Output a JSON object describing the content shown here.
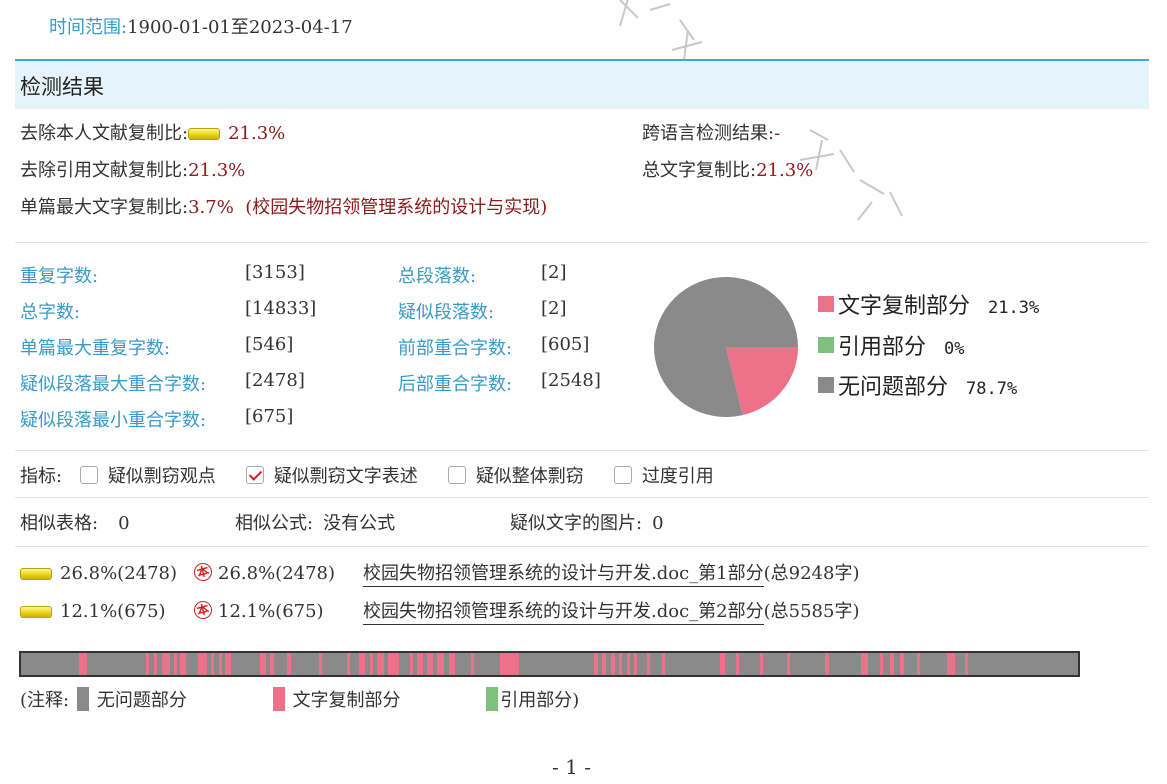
{
  "time_range": {
    "label": "时间范围:",
    "value": "1900-01-01至2023-04-17"
  },
  "header": {
    "title": "检测结果"
  },
  "results": {
    "excl_self_label": "去除本人文献复制比:",
    "excl_self_value": "21.3%",
    "cross_lang_label": "跨语言检测结果:",
    "cross_lang_value": "-",
    "excl_ref_label": "去除引用文献复制比:",
    "excl_ref_value": "21.3%",
    "total_ratio_label": "总文字复制比:",
    "total_ratio_value": "21.3%",
    "max_single_label": "单篇最大文字复制比:",
    "max_single_value": "3.7%",
    "max_single_source": "(校园失物招领管理系统的设计与实现)"
  },
  "stats": [
    {
      "label": "重复字数:",
      "value": "[3153]"
    },
    {
      "label": "总段落数:",
      "value": "[2]"
    },
    {
      "label": "总字数:",
      "value": "[14833]"
    },
    {
      "label": "疑似段落数:",
      "value": "[2]"
    },
    {
      "label": "单篇最大重复字数:",
      "value": "[546]"
    },
    {
      "label": "前部重合字数:",
      "value": "[605]"
    },
    {
      "label": "疑似段落最大重合字数:",
      "value": "[2478]"
    },
    {
      "label": "后部重合字数:",
      "value": "[2548]"
    },
    {
      "label": "疑似段落最小重合字数:",
      "value": "[675]"
    }
  ],
  "chart_data": {
    "type": "pie",
    "slices": [
      {
        "label": "文字复制部分",
        "value": 21.3,
        "pct_label": "21.3%",
        "color": "#ec7189"
      },
      {
        "label": "引用部分",
        "value": 0,
        "pct_label": "0%",
        "color": "#7fc07f"
      },
      {
        "label": "无问题部分",
        "value": 78.7,
        "pct_label": "78.7%",
        "color": "#8a8a8a"
      }
    ]
  },
  "indicators": {
    "label": "指标:",
    "items": [
      {
        "label": "疑似剽窃观点",
        "checked": false
      },
      {
        "label": "疑似剽窃文字表述",
        "checked": true
      },
      {
        "label": "疑似整体剽窃",
        "checked": false
      },
      {
        "label": "过度引用",
        "checked": false
      }
    ]
  },
  "similar": {
    "tables_label": "相似表格:",
    "tables_value": "0",
    "formulas_label": "相似公式:",
    "formulas_value": "没有公式",
    "images_label": "疑似文字的图片:",
    "images_value": "0"
  },
  "sources": [
    {
      "ratio": "26.8%(2478)",
      "own_ratio": "26.8%(2478)",
      "title": "校园失物招领管理系统的设计与开发.doc_第1部分",
      "total": "(总9248字)"
    },
    {
      "ratio": "12.1%(675)",
      "own_ratio": "12.1%(675)",
      "title": "校园失物招领管理系统的设计与开发.doc_第2部分",
      "total": "(总5585字)"
    }
  ],
  "stamp_char": "本",
  "strip_marks": [
    {
      "s": 0.055,
      "w": 0.007
    },
    {
      "s": 0.118,
      "w": 0.003
    },
    {
      "s": 0.126,
      "w": 0.003
    },
    {
      "s": 0.133,
      "w": 0.008
    },
    {
      "s": 0.145,
      "w": 0.003
    },
    {
      "s": 0.15,
      "w": 0.006
    },
    {
      "s": 0.167,
      "w": 0.009
    },
    {
      "s": 0.18,
      "w": 0.003
    },
    {
      "s": 0.187,
      "w": 0.003
    },
    {
      "s": 0.193,
      "w": 0.006
    },
    {
      "s": 0.226,
      "w": 0.006
    },
    {
      "s": 0.236,
      "w": 0.003
    },
    {
      "s": 0.252,
      "w": 0.003
    },
    {
      "s": 0.282,
      "w": 0.003
    },
    {
      "s": 0.308,
      "w": 0.003
    },
    {
      "s": 0.32,
      "w": 0.005
    },
    {
      "s": 0.33,
      "w": 0.003
    },
    {
      "s": 0.337,
      "w": 0.006
    },
    {
      "s": 0.347,
      "w": 0.011
    },
    {
      "s": 0.368,
      "w": 0.003
    },
    {
      "s": 0.375,
      "w": 0.005
    },
    {
      "s": 0.384,
      "w": 0.006
    },
    {
      "s": 0.394,
      "w": 0.006
    },
    {
      "s": 0.405,
      "w": 0.006
    },
    {
      "s": 0.426,
      "w": 0.003
    },
    {
      "s": 0.453,
      "w": 0.018
    },
    {
      "s": 0.542,
      "w": 0.004
    },
    {
      "s": 0.55,
      "w": 0.003
    },
    {
      "s": 0.558,
      "w": 0.004
    },
    {
      "s": 0.566,
      "w": 0.003
    },
    {
      "s": 0.573,
      "w": 0.003
    },
    {
      "s": 0.58,
      "w": 0.003
    },
    {
      "s": 0.592,
      "w": 0.003
    },
    {
      "s": 0.606,
      "w": 0.003
    },
    {
      "s": 0.661,
      "w": 0.005
    },
    {
      "s": 0.676,
      "w": 0.003
    },
    {
      "s": 0.699,
      "w": 0.003
    },
    {
      "s": 0.725,
      "w": 0.003
    },
    {
      "s": 0.761,
      "w": 0.003
    },
    {
      "s": 0.795,
      "w": 0.006
    },
    {
      "s": 0.813,
      "w": 0.003
    },
    {
      "s": 0.822,
      "w": 0.004
    },
    {
      "s": 0.832,
      "w": 0.003
    },
    {
      "s": 0.848,
      "w": 0.003
    },
    {
      "s": 0.876,
      "w": 0.008
    },
    {
      "s": 0.893,
      "w": 0.003
    }
  ],
  "annotation": {
    "prefix": "(注释:",
    "ok_label": "无问题部分",
    "copy_label": "文字复制部分",
    "ref_label": "引用部分)",
    "ok_color": "#8a8a8a",
    "copy_color": "#ec7189",
    "ref_color": "#7fc07f"
  },
  "page_number": "- 1 -"
}
